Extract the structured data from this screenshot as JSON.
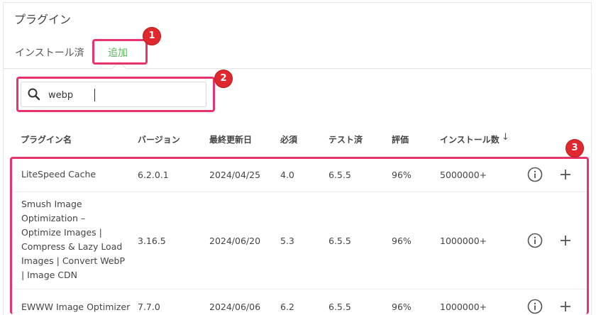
{
  "page": {
    "title": "プラグイン"
  },
  "tabs": [
    {
      "label": "インストール済"
    },
    {
      "label": "追加"
    }
  ],
  "search": {
    "value": "webp"
  },
  "table": {
    "headers": [
      "プラグイン名",
      "バージョン",
      "最終更新日",
      "必須",
      "テスト済",
      "評価",
      "インストール数"
    ],
    "sort_indicator": "↓",
    "rows": [
      {
        "name": "LiteSpeed Cache",
        "version": "6.2.0.1",
        "updated": "2024/04/25",
        "requires": "4.0",
        "tested": "6.5.5",
        "rating": "96%",
        "installs": "5000000+"
      },
      {
        "name": "Smush Image Optimization – Optimize Images | Compress & Lazy Load Images | Convert WebP | Image CDN",
        "version": "3.16.5",
        "updated": "2024/06/20",
        "requires": "5.3",
        "tested": "6.5.5",
        "rating": "96%",
        "installs": "1000000+"
      },
      {
        "name": "EWWW Image Optimizer",
        "version": "7.7.0",
        "updated": "2024/06/06",
        "requires": "6.2",
        "tested": "6.5.5",
        "rating": "96%",
        "installs": "1000000+"
      }
    ]
  },
  "annotations": [
    "1",
    "2",
    "3"
  ],
  "colors": {
    "accent_green": "#5cb85c",
    "highlight": "#e8336d",
    "badge": "#e0282f"
  }
}
